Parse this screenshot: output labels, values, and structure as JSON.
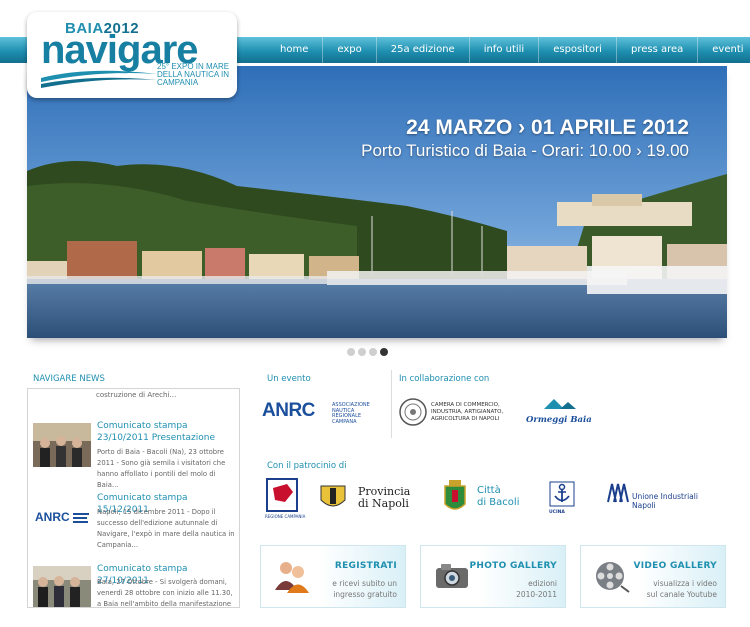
{
  "logo": {
    "brand": "BAIA",
    "year": "2012",
    "name": "navigare",
    "subtitle": "25° EXPO IN MARE DELLA NAUTICA IN CAMPANIA"
  },
  "nav": [
    "home",
    "expo",
    "25a edizione",
    "info utili",
    "espositori",
    "press area",
    "eventi"
  ],
  "hero": {
    "date": "24 MARZO › 01 APRILE 2012",
    "place": "Porto Turistico di Baia - Orari: 10.00 › 19.00"
  },
  "slider": {
    "count": 4,
    "active_index": 3
  },
  "news": {
    "title": "NAVIGARE NEWS",
    "cut_text": "costruzione di Arechi…",
    "items": [
      {
        "title": "Comunicato stampa 23/10/2011 Presentazione",
        "text": "Porto di Baia - Bacoli (Na), 23 ottobre 2011 - Sono già semila i visitatori che hanno affollato i pontili del molo di Baia…"
      },
      {
        "title": "Comunicato stampa 15/12/2011",
        "text": "Napoli, 15 dicembre 2011 - Dopo il successo dell'edizione autunnale di Navigare, l'expò in mare della nautica in Campania…"
      },
      {
        "title": "Comunicato stampa 27/10/2011",
        "text": "Baia, 27 Ottobre - Si svolgerà domani, venerdì 28 ottobre con inizio alle 11.30, a Baia nell'ambito della manifestazione"
      }
    ]
  },
  "partners": {
    "event_label": "Un evento",
    "collab_label": "In collaborazione con",
    "patron_label": "Con il patrocinio di",
    "anrc": {
      "name": "ANRC",
      "desc_1": "ASSOCIAZIONE",
      "desc_2": "NAUTICA",
      "desc_3": "REGIONALE",
      "desc_4": "CAMPANA"
    },
    "camera": {
      "line_1": "CAMERA DI COMMERCIO,",
      "line_2": "INDUSTRIA, ARTIGIANATO,",
      "line_3": "AGRICOLTURA DI NAPOLI"
    },
    "ormeggi": "Ormeggi Baia",
    "regione": "REGIONE CAMPANIA",
    "provincia_1": "Provincia",
    "provincia_2": "di Napoli",
    "citta_1": "Città",
    "citta_2": "di Bacoli",
    "ucina": "UCINA",
    "unione_1": "Unione Industriali",
    "unione_2": "Napoli"
  },
  "boxes": [
    {
      "title": "REGISTRATI",
      "text_1": "e ricevi subito un",
      "text_2": "ingresso gratuito",
      "icon": "users-icon"
    },
    {
      "title": "PHOTO GALLERY",
      "text_1": "edizioni",
      "text_2": "2010-2011",
      "icon": "camera-icon"
    },
    {
      "title": "VIDEO GALLERY",
      "text_1": "visualizza i video",
      "text_2": "sul canale Youtube",
      "icon": "film-reel-icon"
    }
  ],
  "colors": {
    "accent": "#1f8fb0",
    "nav_dark": "#136f8e",
    "anrc_blue": "#1b4f9c"
  }
}
